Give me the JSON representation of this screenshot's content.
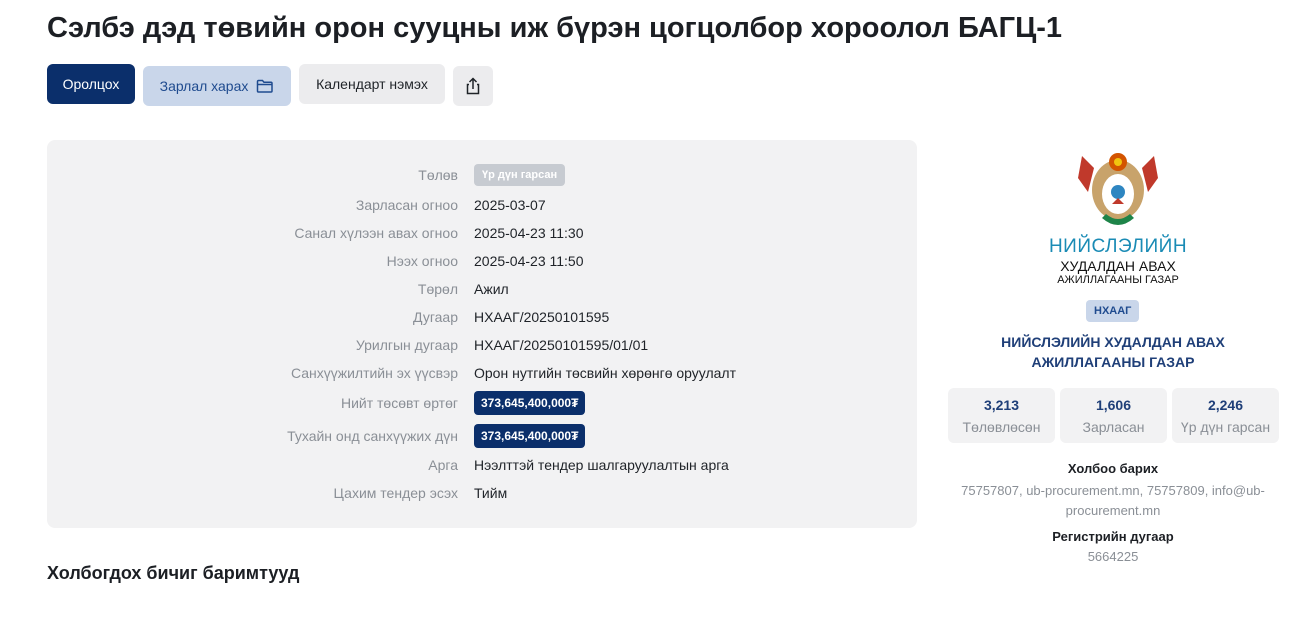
{
  "page": {
    "title": "Сэлбэ дэд төвийн орон сууцны иж бүрэн цогцолбор хороолол БАГЦ-1"
  },
  "actions": {
    "participate": "Оролцох",
    "watch": "Зарлал харах",
    "calendar": "Календарт нэмэх"
  },
  "details": [
    {
      "label": "Төлөв",
      "value": "Үр дүн гарсан",
      "kind": "badge-gray"
    },
    {
      "label": "Зарласан огноо",
      "value": "2025-03-07",
      "kind": "text"
    },
    {
      "label": "Санал хүлээн авах огноо",
      "value": "2025-04-23 11:30",
      "kind": "text"
    },
    {
      "label": "Нээх огноо",
      "value": "2025-04-23 11:50",
      "kind": "text"
    },
    {
      "label": "Төрөл",
      "value": "Ажил",
      "kind": "text"
    },
    {
      "label": "Дугаар",
      "value": "НХААГ/20250101595",
      "kind": "text"
    },
    {
      "label": "Урилгын дугаар",
      "value": "НХААГ/20250101595/01/01",
      "kind": "text"
    },
    {
      "label": "Санхүүжилтийн эх үүсвэр",
      "value": "Орон нутгийн төсвийн хөрөнгө оруулалт",
      "kind": "text"
    },
    {
      "label": "Нийт төсөвт өртөг",
      "value": "373,645,400,000₮",
      "kind": "badge-money"
    },
    {
      "label": "Тухайн онд санхүүжих дүн",
      "value": "373,645,400,000₮",
      "kind": "badge-money"
    },
    {
      "label": "Арга",
      "value": "Нээлттэй тендер шалгаруулалтын арга",
      "kind": "text"
    },
    {
      "label": "Цахим тендер эсэх",
      "value": "Тийм",
      "kind": "text"
    }
  ],
  "documents": {
    "title": "Холбогдох бичиг баримтууд"
  },
  "organization": {
    "logo_line1": "НИЙСЛЭЛИЙН",
    "logo_line2": "ХУДАЛДАН АВАХ",
    "logo_line3": "АЖИЛЛАГААНЫ ГАЗАР",
    "abbr": "НХААГ",
    "name_line1": "НИЙСЛЭЛИЙН ХУДАЛДАН АВАХ",
    "name_line2": "АЖИЛЛАГААНЫ ГАЗАР",
    "stats": [
      {
        "value": "3,213",
        "caption": "Төлөвлөсөн"
      },
      {
        "value": "1,606",
        "caption": "Зарласан"
      },
      {
        "value": "2,246",
        "caption": "Үр дүн гарсан"
      }
    ],
    "contact_label": "Холбоо барих",
    "contact_line1": "75757807, ub-procurement.mn, 75757809, info@ub-",
    "contact_line2": "procurement.mn",
    "reg_label": "Регистрийн дугаар",
    "reg_value": "5664225"
  },
  "colors": {
    "primary": "#0b2f6b",
    "accent_light": "#c9d6ea",
    "panel_bg": "#f2f2f3"
  }
}
